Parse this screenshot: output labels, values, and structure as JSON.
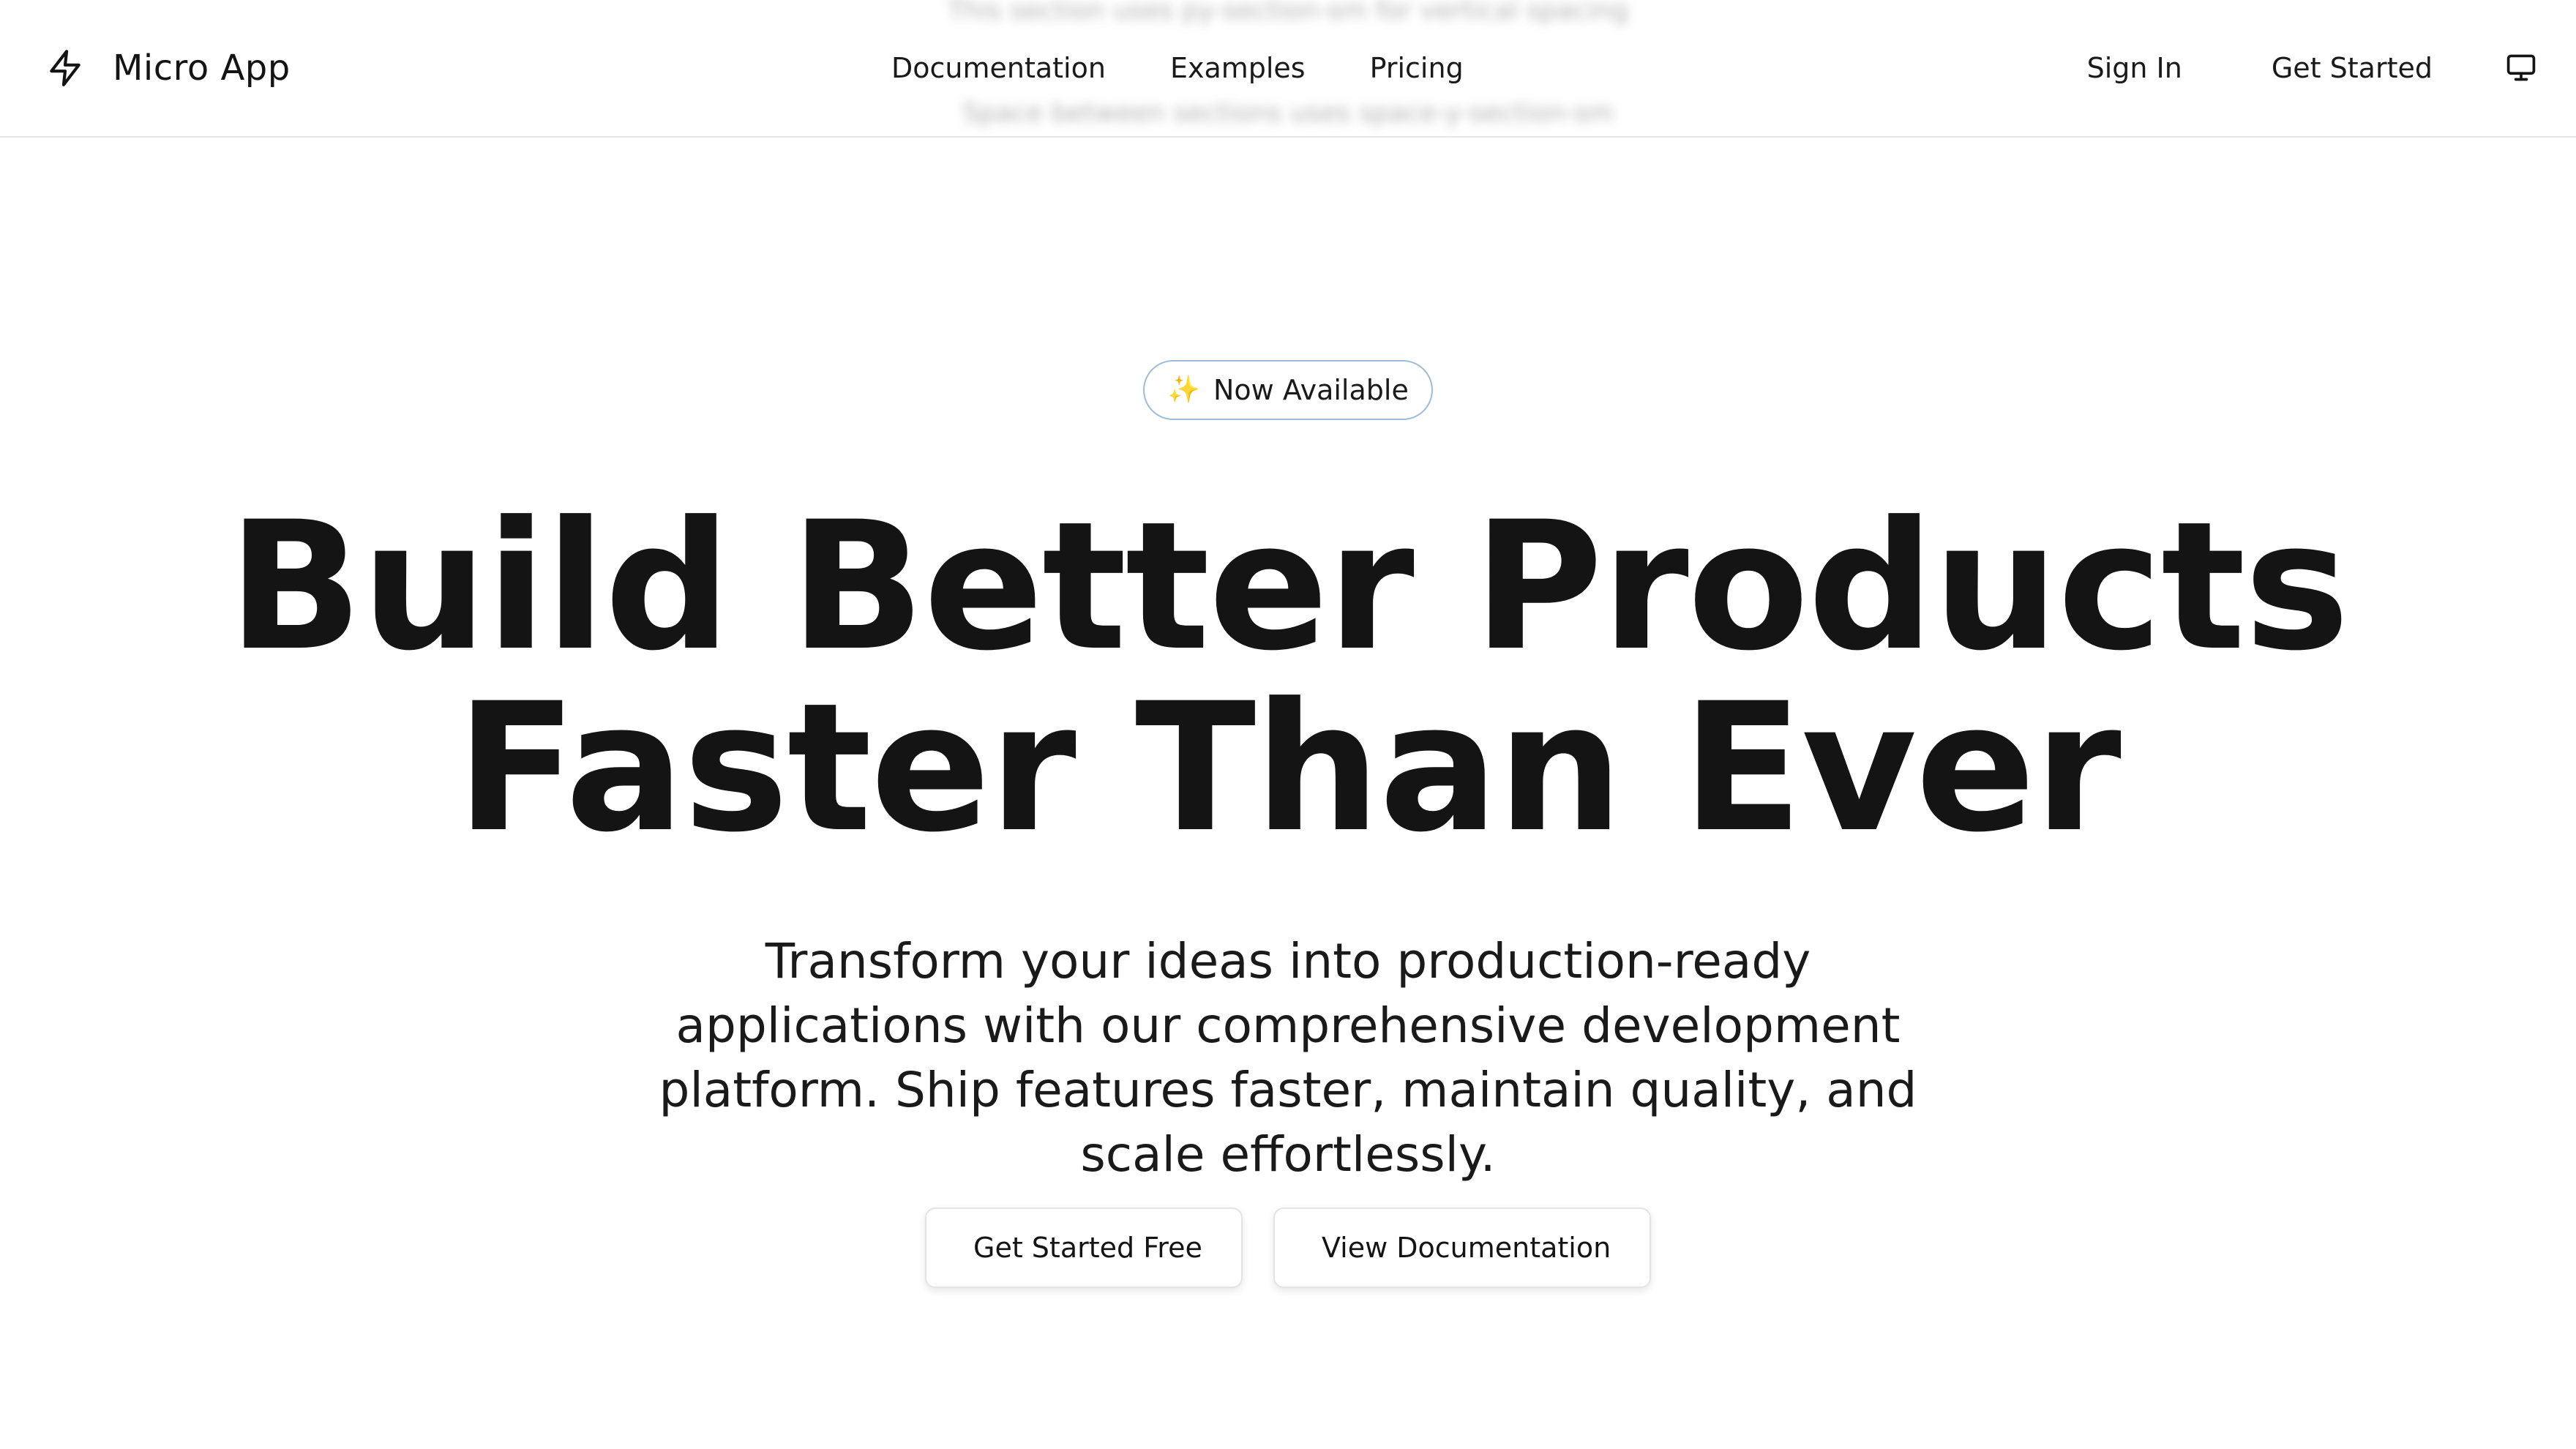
{
  "header": {
    "ghost_top": "This section uses py-section-sm for vertical spacing",
    "ghost_bottom": "Space between sections uses space-y-section-sm",
    "brand": {
      "icon": "lightning-bolt-icon",
      "label": "Micro App"
    },
    "nav": [
      {
        "label": "Documentation"
      },
      {
        "label": "Examples"
      },
      {
        "label": "Pricing"
      }
    ],
    "sign_in_label": "Sign In",
    "get_started_label": "Get Started",
    "display_toggle_icon": "monitor-icon"
  },
  "hero": {
    "badge": {
      "icon": "sparkles-icon",
      "label": "Now Available"
    },
    "title_line1": "Build Better Products",
    "title_line2": "Faster Than Ever",
    "subtitle": "Transform your ideas into production-ready applications with our comprehensive development platform. Ship features faster, maintain quality, and scale effortlessly.",
    "primary_cta": "Get Started Free",
    "secondary_cta": "View Documentation"
  },
  "colors": {
    "text": "#141414",
    "background": "#ffffff",
    "border": "#e6e6e6",
    "badge_border": "#9dbbd8",
    "sparkle": "#e8a33a"
  }
}
